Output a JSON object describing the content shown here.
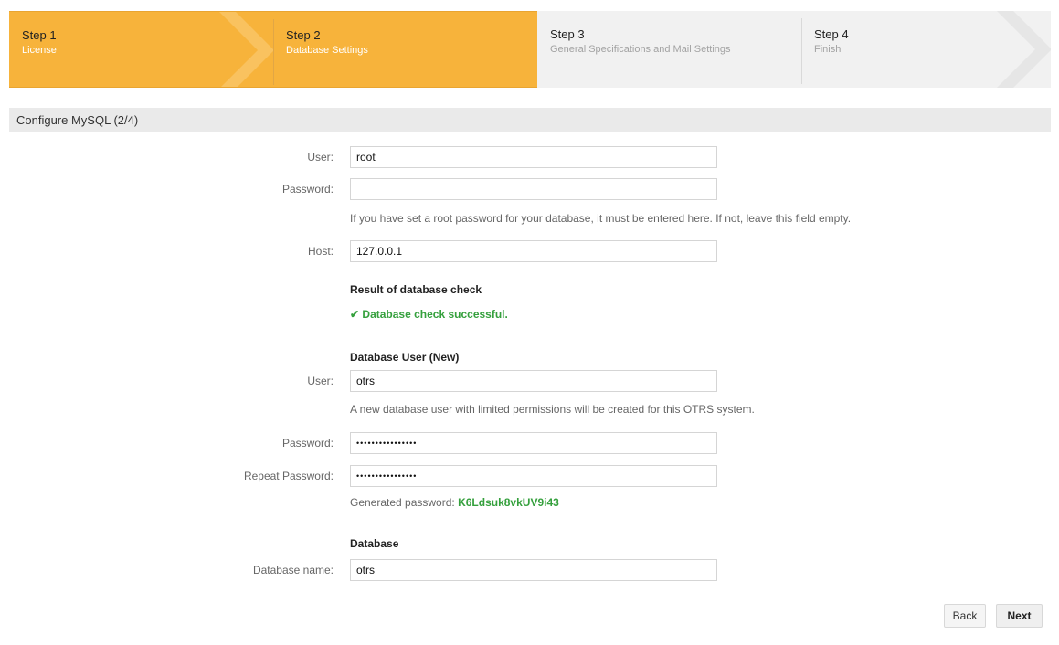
{
  "steps": [
    {
      "number": "Step 1",
      "description": "License",
      "active": true
    },
    {
      "number": "Step 2",
      "description": "Database Settings",
      "active": true
    },
    {
      "number": "Step 3",
      "description": "General Specifications and Mail Settings",
      "active": false
    },
    {
      "number": "Step 4",
      "description": "Finish",
      "active": false
    }
  ],
  "section": {
    "title": "Configure MySQL (2/4)"
  },
  "form": {
    "admin_user_label": "User:",
    "admin_user_value": "root",
    "admin_password_label": "Password:",
    "admin_password_value": "",
    "admin_password_hint": "If you have set a root password for your database, it must be entered here. If not, leave this field empty.",
    "host_label": "Host:",
    "host_value": "127.0.0.1",
    "check_heading": "Result of database check",
    "check_result": "Database check successful.",
    "new_user_heading": "Database User (New)",
    "db_user_label": "User:",
    "db_user_value": "otrs",
    "db_user_hint": "A new database user with limited permissions will be created for this OTRS system.",
    "db_password_label": "Password:",
    "db_password_value": "••••••••••••••••",
    "repeat_password_label": "Repeat Password:",
    "repeat_password_value": "••••••••••••••••",
    "generated_password_label": "Generated password:",
    "generated_password_value": "K6Ldsuk8vkUV9i43",
    "database_heading": "Database",
    "database_name_label": "Database name:",
    "database_name_value": "otrs"
  },
  "buttons": {
    "back": "Back",
    "next": "Next"
  },
  "colors": {
    "active_step": "#f7b33b",
    "inactive_step": "#f1f1f1",
    "success": "#35a03d"
  }
}
